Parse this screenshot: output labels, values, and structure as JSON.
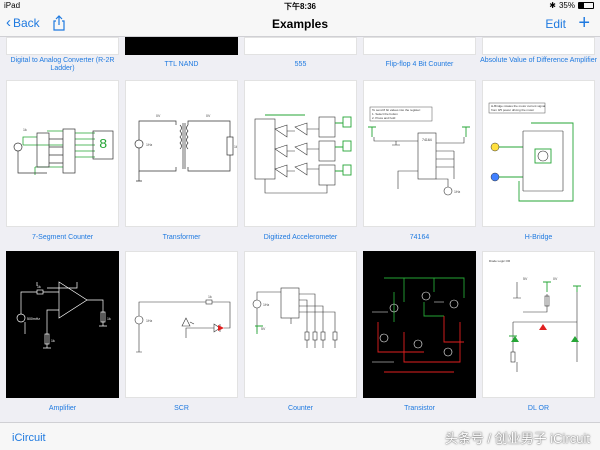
{
  "status": {
    "device": "iPad",
    "time": "下午8:36",
    "battery": "35%"
  },
  "nav": {
    "back": "Back",
    "title": "Examples",
    "edit": "Edit"
  },
  "rows": [
    [
      "Digital to Analog Converter (R-2R Ladder)",
      "TTL NAND",
      "555",
      "Flip-flop 4 Bit Counter",
      "Absolute Value of Difference Amplifier"
    ],
    [
      "7-Segment Counter",
      "Transformer",
      "Digitized Accelerometer",
      "74164",
      "H-Bridge"
    ],
    [
      "Amplifier",
      "SCR",
      "Counter",
      "Transistor",
      "DL OR"
    ]
  ],
  "thumb_text": {
    "seg": {
      "r1": "1k"
    },
    "trans": {
      "v1": "0V",
      "v2": "0V",
      "src": "1Hz",
      "load": "1k"
    },
    "s74164": {
      "note1": "To send 8 bit values into the register:",
      "note2": "1. Select the button",
      "note3": "2. Press and hold",
      "chip": "74164",
      "src": "1Hz"
    },
    "hbridge": {
      "note1": "H-Bridge rotates the motor current signal",
      "note2": "from 0/5 power driving the motor"
    },
    "amp": {
      "r1": "1k",
      "src": "500mHz",
      "r2": "1k",
      "r3": "1k"
    },
    "scr": {
      "src": "1Hz",
      "r": "1k"
    },
    "counter": {
      "src": "1Hz",
      "v": "5V"
    },
    "dlor": {
      "title": "Diode Logic OR",
      "v1": "5V",
      "v2": "0V"
    }
  },
  "tabbar": {
    "app": "iCircuit",
    "watermark": "头条号 / 创业男子 iCircuit"
  },
  "colors": {
    "accent": "#1f7ae0",
    "wire": "#25a535",
    "probe": "#e02020"
  }
}
